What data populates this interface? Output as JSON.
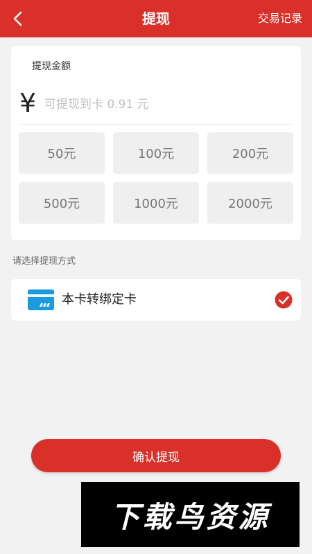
{
  "header": {
    "title": "提现",
    "transactions_link": "交易记录",
    "back_icon": "chevron-left-icon"
  },
  "amount": {
    "label": "提现金额",
    "currency_symbol": "¥",
    "placeholder": "可提现到卡 0.91 元",
    "value": "",
    "presets": [
      "50元",
      "100元",
      "200元",
      "500元",
      "1000元",
      "2000元"
    ]
  },
  "method": {
    "hint": "请选择提现方式",
    "options": [
      {
        "label": "本卡转绑定卡",
        "icon": "bank-card-icon",
        "selected": true
      }
    ]
  },
  "confirm_label": "确认提现",
  "watermark": {
    "text": "下载鸟资源"
  },
  "colors": {
    "primary": "#d9312a",
    "background": "#f2f2f2",
    "card_icon": "#1a9be0"
  }
}
